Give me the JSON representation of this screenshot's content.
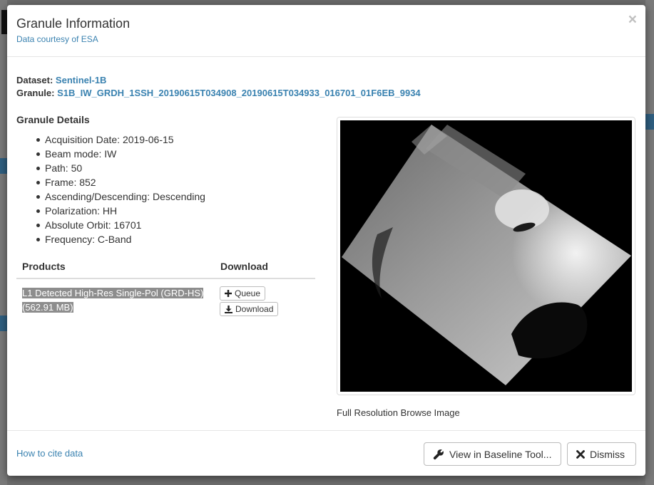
{
  "modal": {
    "title": "Granule Information",
    "subtitle": "Data courtesy of ESA",
    "close_glyph": "×"
  },
  "meta": {
    "dataset_label": "Dataset:",
    "dataset_value": "Sentinel-1B",
    "granule_label": "Granule:",
    "granule_value": "S1B_IW_GRDH_1SSH_20190615T034908_20190615T034933_016701_01F6EB_9934"
  },
  "details": {
    "title": "Granule Details",
    "items": [
      "Acquisition Date: 2019-06-15",
      "Beam mode: IW",
      "Path: 50",
      "Frame: 852",
      "Ascending/Descending: Descending",
      "Polarization: HH",
      "Absolute Orbit: 16701",
      "Frequency: C-Band"
    ]
  },
  "products": {
    "col_products": "Products",
    "col_download": "Download",
    "row": {
      "name": "L1 Detected High-Res Single-Pol (GRD-HS) (562.91 MB)",
      "queue_label": "Queue",
      "download_label": "Download"
    }
  },
  "browse": {
    "caption": "Full Resolution Browse Image"
  },
  "footer": {
    "cite_link": "How to cite data",
    "baseline_label": "View in Baseline Tool...",
    "dismiss_label": "Dismiss"
  },
  "icons": {
    "queue": "plus-icon",
    "download": "download-icon",
    "baseline": "wrench-icon",
    "dismiss": "close-icon"
  },
  "colors": {
    "link": "#3a82b0",
    "highlight": "#8d8d8d"
  }
}
